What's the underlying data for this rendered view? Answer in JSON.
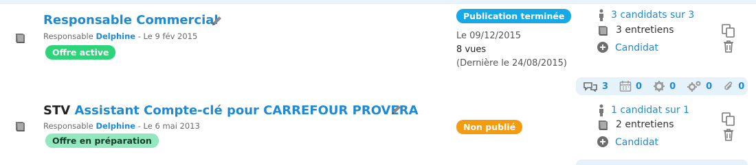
{
  "offers": [
    {
      "title_prefix": "",
      "title": "Responsable Commercial",
      "manager_prefix": "Responsable ",
      "manager_name": "Delphine",
      "created": " - Le 9 fév 2015",
      "offer_status": "Offre active",
      "publication_status": "Publication terminée",
      "publication_date": "Le 09/12/2015",
      "views": "8 vues",
      "last_view": "(Dernière le 24/08/2015)",
      "candidates": "3 candidats sur 3",
      "interviews": "3 entretiens",
      "add_candidate": "Candidat",
      "stats": {
        "comments": "3",
        "calendar": "0",
        "gear": "0",
        "gears": "0",
        "attachments": "0"
      }
    },
    {
      "title_prefix": "STV ",
      "title": "Assistant Compte-clé pour CARREFOUR PROVERA",
      "manager_prefix": "Responsable ",
      "manager_name": "Delphine",
      "created": " - Le 6 mai 2013",
      "offer_status": "Offre en préparation",
      "publication_status": "Non publié",
      "candidates": "1 candidat sur 1",
      "interviews": "2 entretiens",
      "add_candidate": "Candidat"
    }
  ],
  "colors": {
    "link": "#1f8ad3",
    "active": "#2ed47a",
    "preparing": "#93e8bf",
    "published": "#17a8e6",
    "unpublished": "#f39c12"
  },
  "icons": [
    "book-icon",
    "pencil-icon",
    "person-icon",
    "plus-circle-icon",
    "copy-icon",
    "trash-icon",
    "comments-icon",
    "calendar-icon",
    "gear-icon",
    "gears-icon",
    "paperclip-icon"
  ]
}
